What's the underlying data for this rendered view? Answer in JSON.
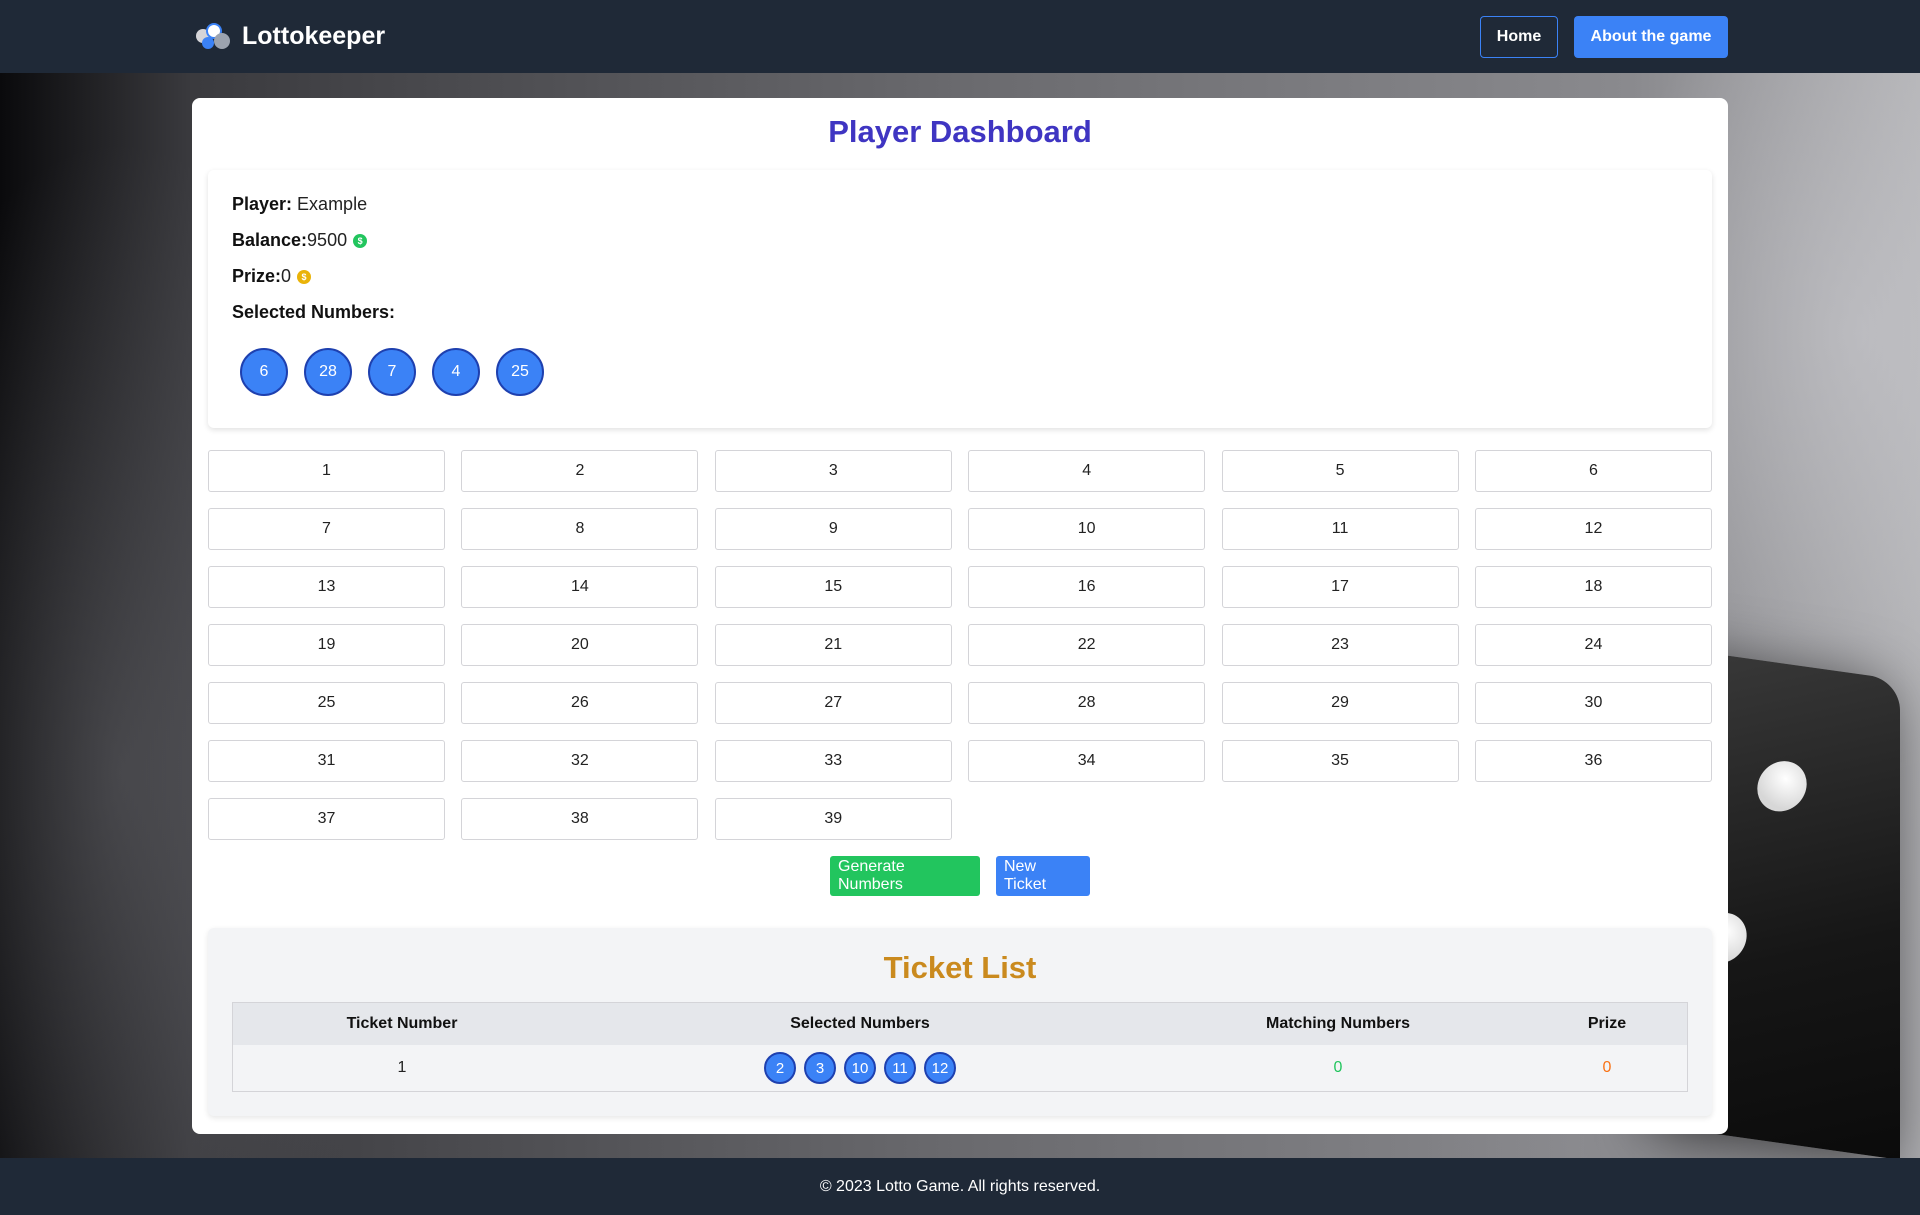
{
  "navbar": {
    "brand": "Lottokeeper",
    "home_label": "Home",
    "about_label": "About the game"
  },
  "dashboard": {
    "title": "Player Dashboard",
    "player_label": "Player:",
    "player_name": "Example",
    "balance_label": "Balance:",
    "balance_value": "9500",
    "prize_label": "Prize:",
    "prize_value": "0",
    "selected_label": "Selected Numbers:",
    "selected_numbers": [
      "6",
      "28",
      "7",
      "4",
      "25"
    ]
  },
  "numbers": [
    "1",
    "2",
    "3",
    "4",
    "5",
    "6",
    "7",
    "8",
    "9",
    "10",
    "11",
    "12",
    "13",
    "14",
    "15",
    "16",
    "17",
    "18",
    "19",
    "20",
    "21",
    "22",
    "23",
    "24",
    "25",
    "26",
    "27",
    "28",
    "29",
    "30",
    "31",
    "32",
    "33",
    "34",
    "35",
    "36",
    "37",
    "38",
    "39"
  ],
  "actions": {
    "generate_label": "Generate Numbers",
    "new_ticket_label": "New Ticket"
  },
  "tickets": {
    "title": "Ticket List",
    "headers": [
      "Ticket Number",
      "Selected Numbers",
      "Matching Numbers",
      "Prize"
    ],
    "rows": [
      {
        "ticket_number": "1",
        "selected_numbers": [
          "2",
          "3",
          "10",
          "11",
          "12"
        ],
        "matching": "0",
        "prize": "0"
      }
    ]
  },
  "footer": {
    "text": "© 2023 Lotto Game. All rights reserved."
  },
  "colors": {
    "navbar": "#1f2937",
    "accent_blue": "#3b82f6",
    "title_purple": "#3f35c2",
    "ticket_title": "#ca8a1e",
    "success_green": "#22c55e",
    "prize_orange": "#f97316"
  },
  "icons": {
    "brand": "lotto-balls-icon",
    "balance": "dollar-coin-green-icon",
    "prize": "dollar-coin-gold-icon"
  }
}
